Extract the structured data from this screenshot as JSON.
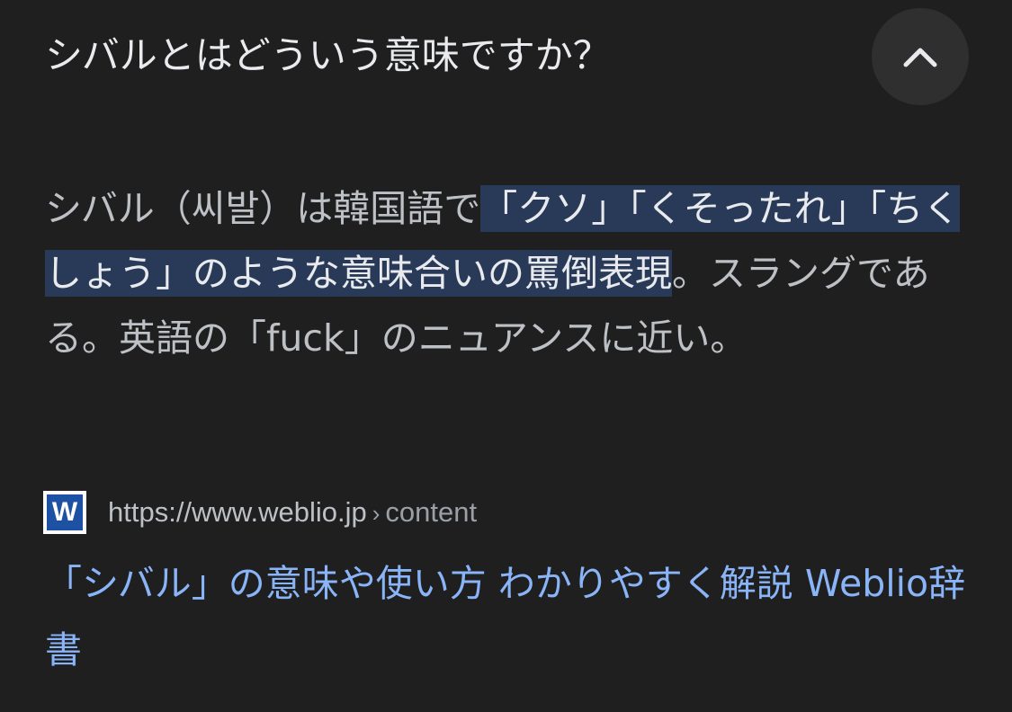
{
  "question": "シバルとはどういう意味ですか？",
  "collapse_icon": "chevron-up-icon",
  "answer": {
    "before": "シバル（씨발）は韓国語で",
    "highlight": "「クソ」「くそったれ」「ちくしょう」のような意味合いの罵倒表現",
    "after": "。スラングである。英語の「fuck」のニュアンスに近い。"
  },
  "source": {
    "favicon_letter": "W",
    "domain": "https://www.weblio.jp",
    "separator": "›",
    "path": "content"
  },
  "result_title": "「シバル」の意味や使い方 わかりやすく解説 Weblio辞書",
  "colors": {
    "background": "#1f1f1f",
    "highlight": "#283a58",
    "link": "#8ab4f8"
  }
}
